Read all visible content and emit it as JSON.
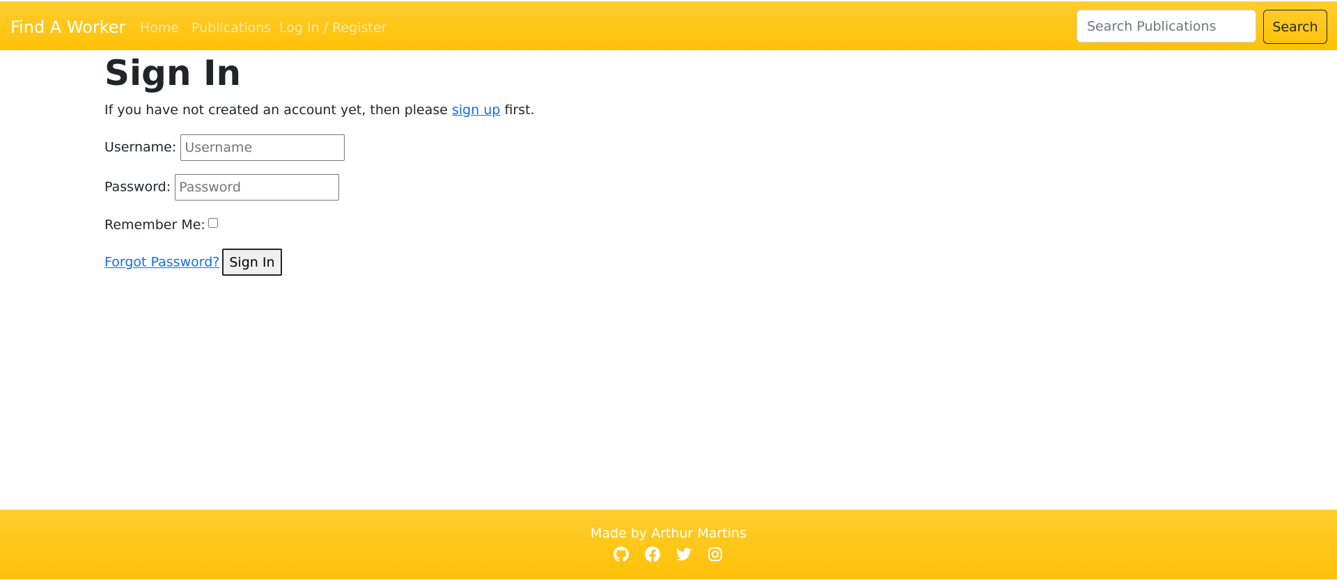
{
  "navbar": {
    "brand": "Find A Worker",
    "links": [
      "Home",
      "Publications",
      "Log In / Register"
    ],
    "search": {
      "placeholder": "Search Publications",
      "value": ""
    },
    "search_button": "Search"
  },
  "main": {
    "title": "Sign In",
    "intro": {
      "before": "If you have not created an account yet, then please ",
      "link": "sign up",
      "after": " first."
    },
    "username": {
      "label": "Username:",
      "placeholder": "Username"
    },
    "password": {
      "label": "Password:",
      "placeholder": "Password"
    },
    "remember": {
      "label": "Remember Me:",
      "checked": false
    },
    "forgot_link": "Forgot Password?",
    "submit": "Sign In"
  },
  "footer": {
    "text": "Made by Arthur Martins",
    "icons": [
      "github-icon",
      "facebook-icon",
      "twitter-icon",
      "instagram-icon"
    ]
  },
  "colors": {
    "brand": "#ffc107",
    "link": "#0d6efd",
    "text": "#212529"
  }
}
